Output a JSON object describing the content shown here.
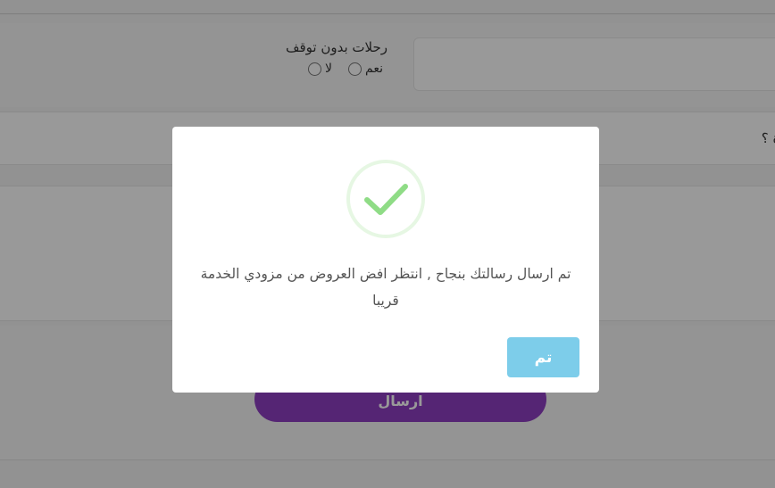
{
  "form": {
    "nonstop_label": "رحلات بدون توقف",
    "option_yes": "نعم",
    "option_no": "لا",
    "partial_question": "دة ؟",
    "submit_label": "ارسال"
  },
  "modal": {
    "message": "تم ارسال رسالتك بنجاح , انتظر افض العروض من مزودي الخدمة قريبا",
    "confirm_label": "تم",
    "icon": "success-check-icon"
  },
  "colors": {
    "submit_button": "#8e3ec1",
    "confirm_button": "#7dcdea",
    "success_check": "#8fdc86",
    "success_ring": "#e6f7e3"
  }
}
